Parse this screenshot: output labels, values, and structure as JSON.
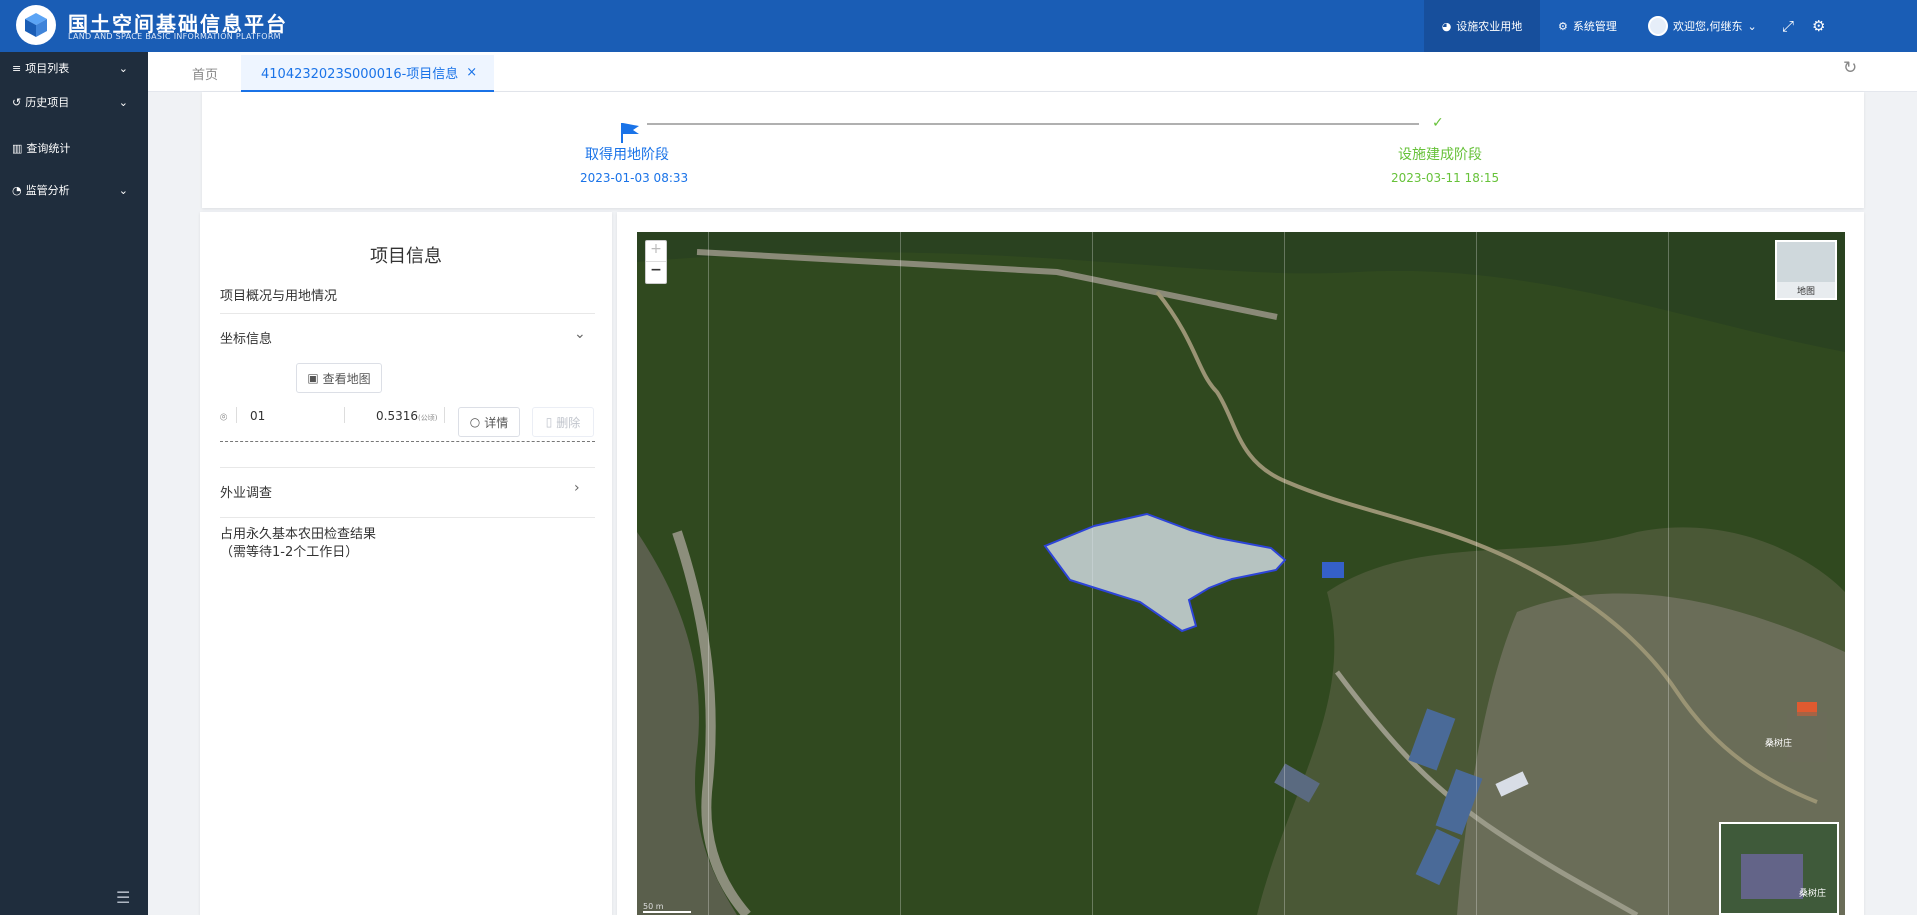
{
  "header": {
    "title": "国土空间基础信息平台",
    "subtitle": "LAND AND SPACE BASIC INFORMATION PLATFORM",
    "nav_items": [
      {
        "label": "设施农业用地"
      },
      {
        "label": "系统管理"
      }
    ],
    "user": "欢迎您,何继东"
  },
  "sidebar": {
    "items": [
      {
        "label": "项目列表"
      },
      {
        "label": "历史项目"
      },
      {
        "label": "查询统计"
      },
      {
        "label": "监管分析"
      }
    ]
  },
  "tabs": [
    {
      "label": "首页"
    },
    {
      "label": "4104232023S000016-项目信息"
    }
  ],
  "steps": [
    {
      "title": "取得用地阶段",
      "date": "2023-01-03 08:33"
    },
    {
      "title": "设施建成阶段",
      "date": "2023-03-11 18:15"
    }
  ],
  "info": {
    "heading": "项目信息",
    "overview": "项目概况与用地情况",
    "coord_label": "坐标信息",
    "view_map_button": "查看地图",
    "parcel": {
      "code": "01",
      "area": "0.5316",
      "unit": "(公顷)",
      "detail_button": "详情",
      "delete_button": "删除"
    },
    "field_survey": "外业调查",
    "farmland_check": "占用永久基本农田检查结果",
    "farmland_note": "（需等待1-2个工作日）"
  },
  "map": {
    "zoom_in": "+",
    "zoom_out": "−",
    "layer_label": "地图",
    "place_label_1": "桑树庄",
    "place_label_2": "桑树庄",
    "scale": "50 m"
  },
  "colors": {
    "header": "#1a5db5",
    "sidebar": "#1f2d3d",
    "accent": "#1a73e8",
    "done": "#67c23a"
  }
}
